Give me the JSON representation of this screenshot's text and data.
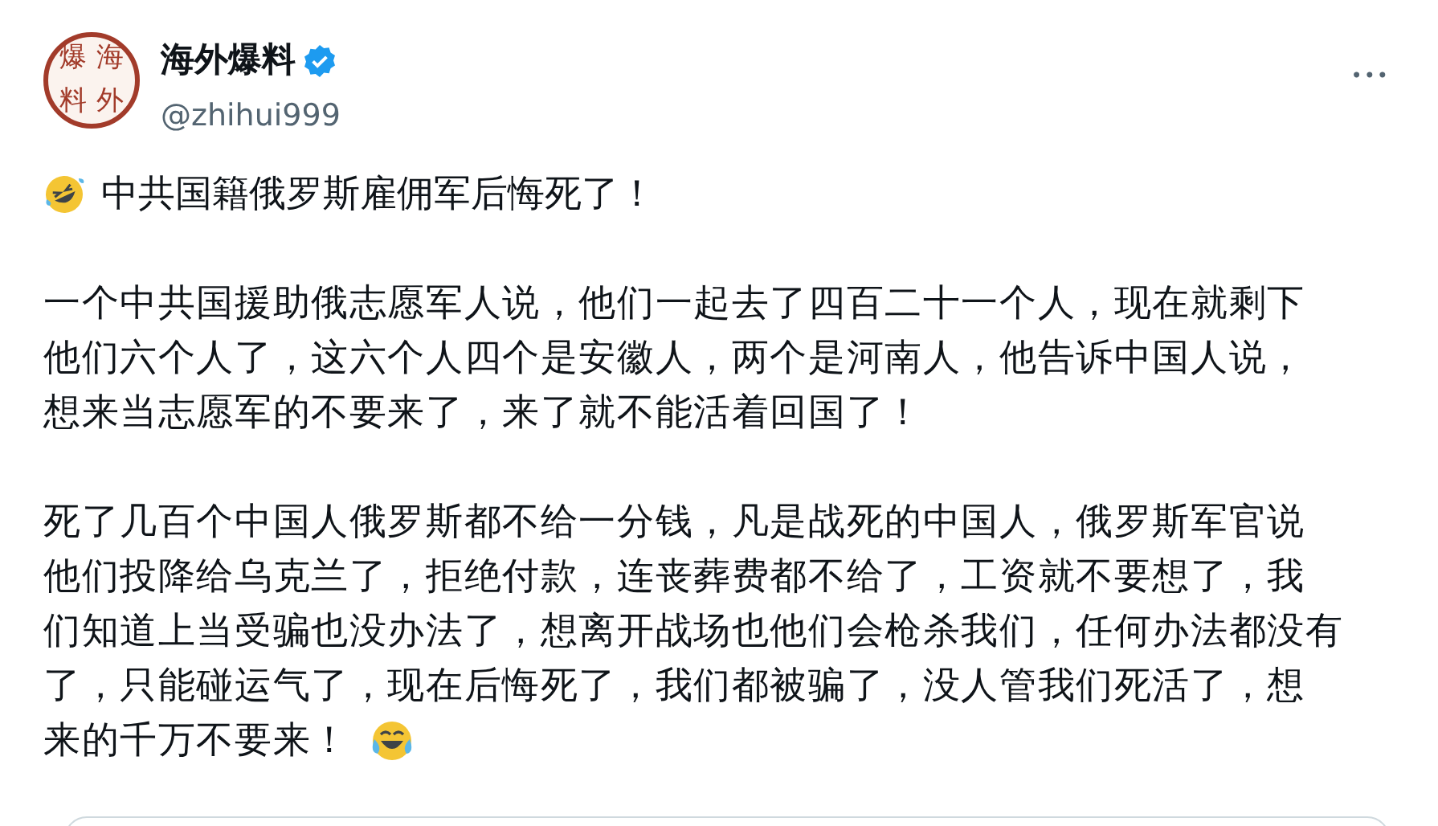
{
  "author": {
    "seal_chars": [
      "爆",
      "海",
      "料",
      "外"
    ],
    "name": "海外爆料",
    "verified": true,
    "handle": "@zhihui999"
  },
  "more_button": "•••",
  "post": {
    "title": "中共国籍俄罗斯雇佣军后悔死了！",
    "paragraphs": [
      {
        "lines": [
          "一个中共国援助俄志愿军人说，他们一起去了四百二十一个人，现在就剩下",
          "他们六个人了，这六个人四个是安徽人，两个是河南人，他告诉中国人说，",
          "想来当志愿军的不要来了，来了就不能活着回国了！"
        ],
        "trailing_emoji": false
      },
      {
        "lines": [
          "死了几百个中国人俄罗斯都不给一分钱，凡是战死的中国人，俄罗斯军官说",
          "他们投降给乌克兰了，拒绝付款，连丧葬费都不给了，工资就不要想了，我",
          "们知道上当受骗也没办法了，想离开战场也他们会枪杀我们，任何办法都没有",
          "了，只能碰运气了，现在后悔死了，我们都被骗了，没人管我们死活了，想",
          "来的千万不要来！"
        ],
        "trailing_emoji": true
      }
    ]
  }
}
